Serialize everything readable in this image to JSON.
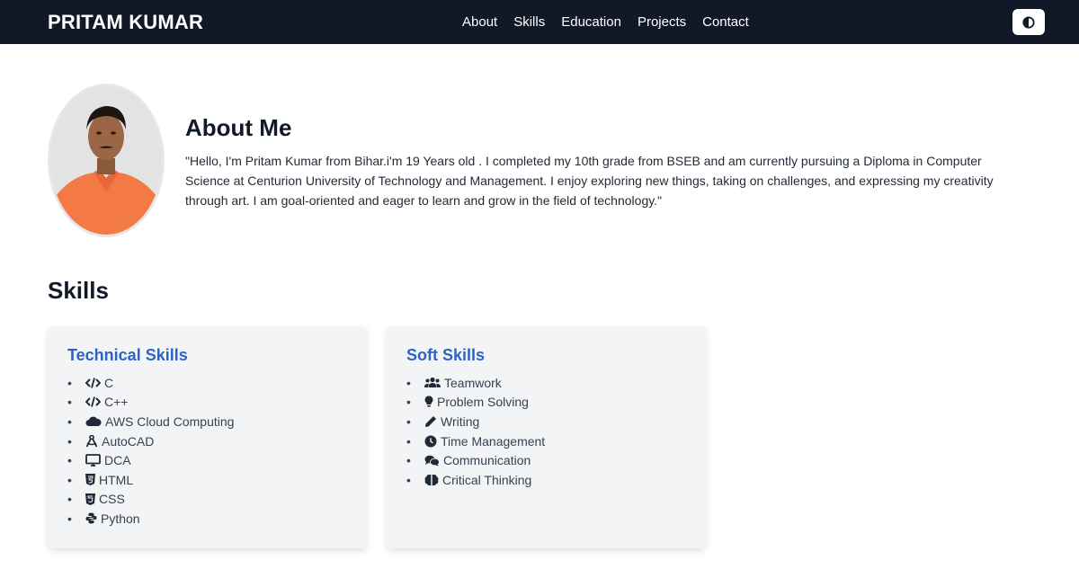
{
  "nav": {
    "brand": "PRITAM KUMAR",
    "links": [
      "About",
      "Skills",
      "Education",
      "Projects",
      "Contact"
    ]
  },
  "about": {
    "title": "About Me",
    "text": "\"Hello, I'm Pritam Kumar from Bihar.i'm 19 Years old . I completed my 10th grade from BSEB and am currently pursuing a Diploma in Computer Science at Centurion University of Technology and Management. I enjoy exploring new things, taking on challenges, and expressing my creativity through art. I am goal-oriented and eager to learn and grow in the field of technology.\""
  },
  "skills": {
    "title": "Skills",
    "technical": {
      "title": "Technical Skills",
      "items": [
        {
          "label": "C",
          "icon": "code-icon"
        },
        {
          "label": "C++",
          "icon": "code-icon"
        },
        {
          "label": "AWS Cloud Computing",
          "icon": "cloud-icon"
        },
        {
          "label": "AutoCAD",
          "icon": "drafting-compass-icon"
        },
        {
          "label": "DCA",
          "icon": "desktop-icon"
        },
        {
          "label": "HTML",
          "icon": "html5-icon"
        },
        {
          "label": "CSS",
          "icon": "css3-icon"
        },
        {
          "label": "Python",
          "icon": "python-icon"
        }
      ]
    },
    "soft": {
      "title": "Soft Skills",
      "items": [
        {
          "label": "Teamwork",
          "icon": "users-icon"
        },
        {
          "label": "Problem Solving",
          "icon": "lightbulb-icon"
        },
        {
          "label": "Writing",
          "icon": "pen-icon"
        },
        {
          "label": "Time Management",
          "icon": "clock-icon"
        },
        {
          "label": "Communication",
          "icon": "comments-icon"
        },
        {
          "label": "Critical Thinking",
          "icon": "brain-icon"
        }
      ]
    }
  },
  "colors": {
    "nav_bg": "#111827",
    "accent": "#2b63c9",
    "card_bg": "#f3f4f6"
  }
}
